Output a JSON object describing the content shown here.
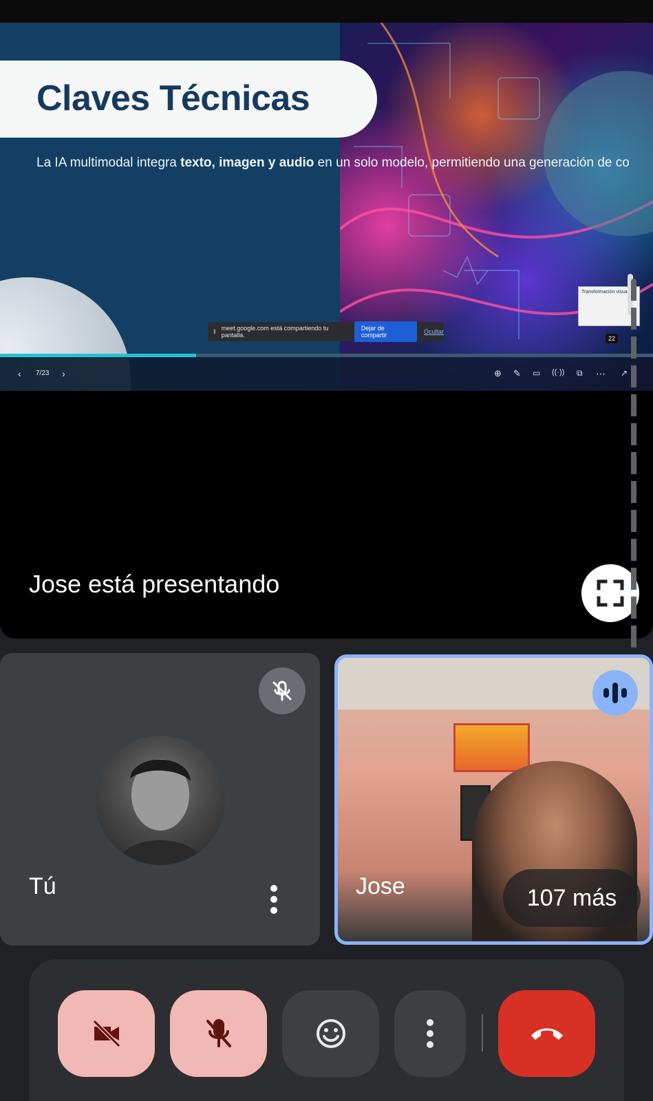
{
  "slide": {
    "title": "Claves Técnicas",
    "body_prefix": "La IA multimodal integra ",
    "body_bold": "texto, imagen y audio",
    "body_suffix": " en un solo modelo, permitiendo una generación de co",
    "page_indicator": "7/23",
    "progress_percent": 30,
    "thumbnail_title": "Transformación visual",
    "badge": "22"
  },
  "share_bar": {
    "message": "meet.google.com está compartiendo tu pantalla.",
    "stop_label": "Dejar de compartir",
    "hide_label": "Ocultar"
  },
  "stage": {
    "presenting_text": "Jose está presentando"
  },
  "tiles": {
    "you": {
      "name": "Tú",
      "muted": true
    },
    "jose": {
      "name": "Jose",
      "speaking": true,
      "more_label": "107 más"
    }
  },
  "controls": {
    "items": [
      "camera-off",
      "mic-off",
      "reactions",
      "more-options",
      "end-call"
    ]
  },
  "colors": {
    "accent": "#8ab4f8",
    "end_call": "#d93025",
    "off_state": "#f2b8b5",
    "tile_bg": "#3c4043"
  }
}
